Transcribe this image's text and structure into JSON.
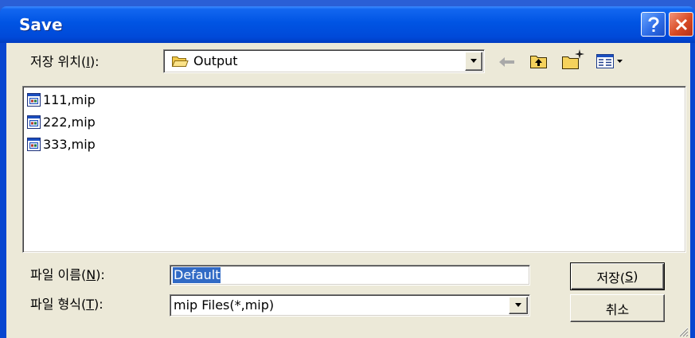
{
  "window": {
    "title": "Save",
    "help_icon": "help-icon",
    "close_icon": "close-icon"
  },
  "save_in": {
    "label": "저장 위치(I):",
    "folder_name": "Output",
    "folder_icon": "folder-icon",
    "dropdown_icon": "chevron-down-icon",
    "toolbar": [
      {
        "icon": "back-arrow-icon",
        "enabled": false
      },
      {
        "icon": "up-folder-icon",
        "enabled": true
      },
      {
        "icon": "new-folder-icon",
        "enabled": true
      },
      {
        "icon": "view-menu-icon",
        "enabled": true
      }
    ]
  },
  "files": [
    {
      "name": "111,mip",
      "icon": "mip-file-icon"
    },
    {
      "name": "222,mip",
      "icon": "mip-file-icon"
    },
    {
      "name": "333,mip",
      "icon": "mip-file-icon"
    }
  ],
  "file_name": {
    "label": "파일 이름(N):",
    "value": "Default",
    "value_selected": true
  },
  "file_type": {
    "label": "파일 형식(T):",
    "value": "mip Files(*,mip)",
    "dropdown_icon": "chevron-down-icon"
  },
  "buttons": {
    "save": "저장(S)",
    "cancel": "취소"
  },
  "colors": {
    "title_bar": "#0054e3",
    "dialog_bg": "#ece9d8",
    "selection_bg": "#316ac5",
    "close_button": "#d84a23",
    "help_button": "#2f6ee8"
  }
}
